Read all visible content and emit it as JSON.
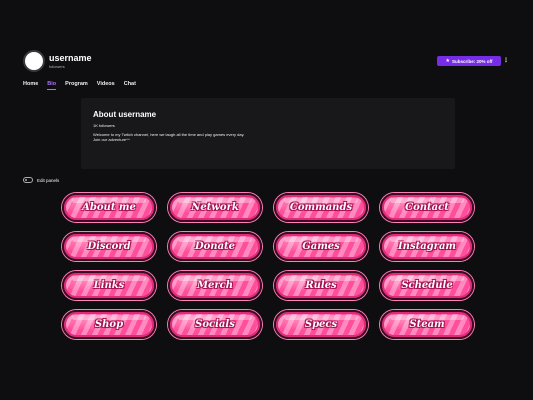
{
  "channel": {
    "name": "username",
    "followers_label": "followers"
  },
  "header": {
    "subscribe_label": "Subscribe: 20% off",
    "more_icon": "more-vertical-icon",
    "subscribe_icon": "star-icon"
  },
  "tabs": [
    {
      "label": "Home",
      "active": false
    },
    {
      "label": "Bio",
      "active": true
    },
    {
      "label": "Program",
      "active": false
    },
    {
      "label": "Videos",
      "active": false
    },
    {
      "label": "Chat",
      "active": false
    }
  ],
  "about": {
    "title": "About username",
    "followers": "1K followers",
    "description_line1": "Welcome to my Twitch channel, here we laugh all the time and play games every day.",
    "description_line2": "Join our adventure^^"
  },
  "edit_panels": {
    "label": "Edit panels"
  },
  "panels": [
    "About me",
    "Network",
    "Commands",
    "Contact",
    "Discord",
    "Donate",
    "Games",
    "Instagram",
    "Links",
    "Merch",
    "Rules",
    "Schedule",
    "Shop",
    "Socials",
    "Specs",
    "Steam"
  ],
  "colors": {
    "background": "#0e0e10",
    "card": "#18181b",
    "accent": "#a970ff",
    "subscribe": "#772ce8",
    "panel_pink": "#ff4f9a"
  }
}
